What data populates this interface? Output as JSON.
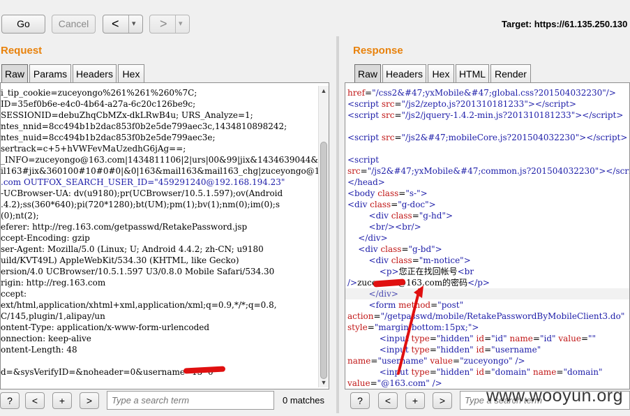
{
  "toolbar": {
    "go_label": "Go",
    "cancel_label": "Cancel",
    "back_label": "<",
    "back_dropdown": "▾",
    "forward_label": ">",
    "forward_dropdown": "▾",
    "target_label": "Target: https://61.135.250.130"
  },
  "request": {
    "title": "Request",
    "tabs": [
      "Raw",
      "Params",
      "Headers",
      "Hex"
    ],
    "lines": [
      "i_tip_cookie=zuceyongo%261%261%260%7C;",
      "ID=35ef0b6e-e4c0-4b64-a27a-6c20c126be9c;",
      "SESSIONID=debuZhqCbMZx-dkLRwB4u; URS_Analyze=1;",
      "ntes_nnid=8cc494b1b2dac853f0b2e5de799aec3c,1434810898242;",
      "ntes_nuid=8cc494b1b2dac853f0b2e5de799aec3e;",
      "sertrack=c+5+hVWFevMaUzedhG6jAg==;",
      "_INFO=zuceyongo@163.com|1434811106|2|urs|00&99|jix&1434639044&m",
      "il163#jix&360100#10#0#0|&0|163&mail163&mail163_chg|zuceyongo@16",
      ".com OUTFOX_SEARCH_USER_ID=\"459291240@192.168.194.23\"",
      "-UCBrowser-UA: dv(u9180);pr(UCBrowser/10.5.1.597);ov(Android",
      ".4.2);ss(360*640);pi(720*1280);bt(UM);pm(1);bv(1);nm(0);im(0);s",
      "(0);nt(2);",
      "eferer: http://reg.163.com/getpasswd/RetakePassword.jsp",
      "ccept-Encoding: gzip",
      "ser-Agent: Mozilla/5.0 (Linux; U; Android 4.4.2; zh-CN; u9180",
      "uild/KVT49L) AppleWebKit/534.30 (KHTML, like Gecko)",
      "ersion/4.0 UCBrowser/10.5.1.597 U3/0.8.0 Mobile Safari/534.30",
      "rigin: http://reg.163.com",
      "ccept:",
      "ext/html,application/xhtml+xml,application/xml;q=0.9,*/*;q=0.8,",
      "C/145,plugin/1,alipay/un",
      "ontent-Type: application/x-www-form-urlencoded",
      "onnection: keep-alive",
      "ontent-Length: 48",
      "",
      "d=&sysVerifyID=&noheader=0&username=15  0"
    ],
    "help_label": "?",
    "prev_label": "<",
    "add_label": "+",
    "next_label": ">",
    "search_placeholder": "Type a search term",
    "matches": "0 matches"
  },
  "response": {
    "title": "Response",
    "tabs": [
      "Raw",
      "Headers",
      "Hex",
      "HTML",
      "Render"
    ],
    "help_label": "?",
    "prev_label": "<",
    "add_label": "+",
    "next_label": ">",
    "search_placeholder": "Type a search term"
  },
  "watermark": "www.wooyun.org",
  "colors": {
    "accent": "#e8820c",
    "tag": "#1c1ca8",
    "attr": "#c01515",
    "redact": "#e01010"
  }
}
